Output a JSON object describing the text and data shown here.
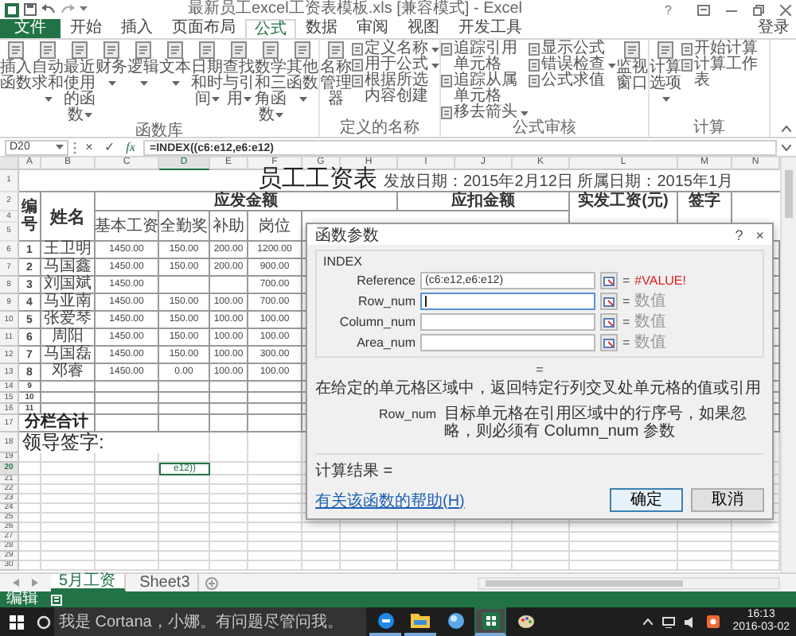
{
  "window": {
    "title": "最新员工excel工资表模板.xls [兼容模式] - Excel",
    "help": "?",
    "sign_in": "登录"
  },
  "ribbon_tabs": [
    {
      "label": "文件",
      "kind": "file",
      "selected": false
    },
    {
      "label": "开始",
      "kind": "tab",
      "selected": false
    },
    {
      "label": "插入",
      "kind": "tab",
      "selected": false
    },
    {
      "label": "页面布局",
      "kind": "tab",
      "selected": false
    },
    {
      "label": "公式",
      "kind": "tab",
      "selected": true
    },
    {
      "label": "数据",
      "kind": "tab",
      "selected": false
    },
    {
      "label": "审阅",
      "kind": "tab",
      "selected": false
    },
    {
      "label": "视图",
      "kind": "tab",
      "selected": false
    },
    {
      "label": "开发工具",
      "kind": "tab",
      "selected": false
    }
  ],
  "ribbon_groups": [
    {
      "label": "函数库",
      "items": [
        {
          "kind": "large",
          "label": "插入函数",
          "dropdown": false
        },
        {
          "kind": "large",
          "label": "自动求和",
          "dropdown": true
        },
        {
          "kind": "large",
          "label": "最近使用的函数",
          "dropdown": true
        },
        {
          "kind": "large",
          "label": "财务",
          "dropdown": true
        },
        {
          "kind": "large",
          "label": "逻辑",
          "dropdown": true
        },
        {
          "kind": "large",
          "label": "文本",
          "dropdown": true
        },
        {
          "kind": "large",
          "label": "日期和时间",
          "dropdown": true
        },
        {
          "kind": "large",
          "label": "查找与引用",
          "dropdown": true
        },
        {
          "kind": "large",
          "label": "数学和三角函数",
          "dropdown": true
        },
        {
          "kind": "large",
          "label": "其他函数",
          "dropdown": true
        }
      ]
    },
    {
      "label": "定义的名称",
      "items": [
        {
          "kind": "large",
          "label": "名称管理器",
          "dropdown": false
        },
        {
          "kind": "stack",
          "items": [
            {
              "label": "定义名称",
              "dropdown": true
            },
            {
              "label": "用于公式",
              "dropdown": true
            },
            {
              "label": "根据所选内容创建",
              "dropdown": false
            }
          ]
        }
      ]
    },
    {
      "label": "公式审核",
      "items": [
        {
          "kind": "stack",
          "items": [
            {
              "label": "追踪引用单元格",
              "dropdown": false
            },
            {
              "label": "追踪从属单元格",
              "dropdown": false
            },
            {
              "label": "移去箭头",
              "dropdown": true
            }
          ]
        },
        {
          "kind": "stack",
          "items": [
            {
              "label": "显示公式",
              "dropdown": false
            },
            {
              "label": "错误检查",
              "dropdown": true
            },
            {
              "label": "公式求值",
              "dropdown": false
            }
          ]
        },
        {
          "kind": "large",
          "label": "监视窗口",
          "dropdown": false
        }
      ]
    },
    {
      "label": "计算",
      "items": [
        {
          "kind": "large",
          "label": "计算选项",
          "dropdown": true
        },
        {
          "kind": "stack",
          "items": [
            {
              "label": "开始计算",
              "dropdown": false
            },
            {
              "label": "计算工作表",
              "dropdown": false
            }
          ]
        }
      ]
    }
  ],
  "formula_bar": {
    "name_box": "D20",
    "cancel": "×",
    "enter": "✓",
    "function": "fx",
    "formula": "=INDEX((c6:e12,e6:e12)"
  },
  "sheet": {
    "columns": [
      {
        "letter": "A",
        "selected": false
      },
      {
        "letter": "B",
        "selected": false
      },
      {
        "letter": "C",
        "selected": false
      },
      {
        "letter": "D",
        "selected": true
      },
      {
        "letter": "E",
        "selected": false
      },
      {
        "letter": "F",
        "selected": false
      },
      {
        "letter": "G",
        "selected": false
      },
      {
        "letter": "H",
        "selected": false
      },
      {
        "letter": "I",
        "selected": false
      },
      {
        "letter": "J",
        "selected": false
      },
      {
        "letter": "K",
        "selected": false
      },
      {
        "letter": "L",
        "selected": false
      },
      {
        "letter": "M",
        "selected": false
      },
      {
        "letter": "N",
        "selected": false
      }
    ],
    "header_row_numbers": [
      "1",
      "2",
      "4",
      "5"
    ],
    "title": "员工工资表",
    "dates": "发放日期：2015年2月12日 所属日期：2015年1月",
    "number_header": "编号",
    "name_header": "姓名",
    "pay_group": "应发金额",
    "deduct_group": "应扣金额",
    "net_header": "实发工资(元)",
    "sign_header": "签字",
    "pay_columns": [
      "基本工资",
      "全勤奖",
      "补助",
      "岗位"
    ],
    "rows": [
      {
        "kind": "person",
        "number": "6",
        "selected": false,
        "no": "1",
        "name": "王卫明",
        "base_pay": "1450.00",
        "attendance_bonus": "150.00",
        "allowance": "200.00",
        "post_pay": "1200.00"
      },
      {
        "kind": "person",
        "number": "7",
        "selected": false,
        "no": "2",
        "name": "马国鑫",
        "base_pay": "1450.00",
        "attendance_bonus": "150.00",
        "allowance": "200.00",
        "post_pay": "900.00"
      },
      {
        "kind": "person",
        "number": "8",
        "selected": false,
        "no": "3",
        "name": "刘国斌",
        "base_pay": "1450.00",
        "post_pay": "700.00"
      },
      {
        "kind": "person",
        "number": "9",
        "selected": false,
        "no": "4",
        "name": "马亚南",
        "base_pay": "1450.00",
        "attendance_bonus": "150.00",
        "allowance": "100.00",
        "post_pay": "700.00"
      },
      {
        "kind": "person",
        "number": "10",
        "selected": false,
        "no": "5",
        "name": "张爱琴",
        "base_pay": "1450.00",
        "attendance_bonus": "150.00",
        "allowance": "100.00",
        "post_pay": "100.00"
      },
      {
        "kind": "person",
        "number": "11",
        "selected": false,
        "no": "6",
        "name": "周阳",
        "base_pay": "1450.00",
        "attendance_bonus": "150.00",
        "allowance": "100.00",
        "post_pay": "100.00"
      },
      {
        "kind": "person",
        "number": "12",
        "selected": false,
        "no": "7",
        "name": "马国磊",
        "base_pay": "1450.00",
        "attendance_bonus": "150.00",
        "allowance": "100.00",
        "post_pay": "300.00"
      },
      {
        "kind": "person",
        "number": "13",
        "selected": false,
        "no": "8",
        "name": "邓睿",
        "base_pay": "1450.00",
        "attendance_bonus": "0.00",
        "allowance": "100.00",
        "post_pay": "100.00"
      },
      {
        "kind": "number",
        "number": "14",
        "selected": false,
        "no": "9"
      },
      {
        "kind": "number",
        "number": "15",
        "selected": false,
        "no": "10"
      },
      {
        "kind": "number",
        "number": "16",
        "selected": false,
        "no": "11"
      },
      {
        "kind": "total",
        "number": "17",
        "selected": false,
        "label": "分栏合计"
      },
      {
        "kind": "sign",
        "number": "18",
        "selected": false,
        "label": "领导签字:"
      },
      {
        "kind": "empty",
        "number": "19",
        "selected": false
      },
      {
        "kind": "edit",
        "number": "20",
        "selected": true,
        "text": "e12))"
      },
      {
        "kind": "empty",
        "number": "21",
        "selected": false
      },
      {
        "kind": "empty",
        "number": "22",
        "selected": false
      },
      {
        "kind": "empty",
        "number": "23",
        "selected": false
      },
      {
        "kind": "empty",
        "number": "24",
        "selected": false
      },
      {
        "kind": "empty",
        "number": "25",
        "selected": false
      },
      {
        "kind": "empty",
        "number": "26",
        "selected": false
      },
      {
        "kind": "empty",
        "number": "27",
        "selected": false
      },
      {
        "kind": "empty",
        "number": "28",
        "selected": false
      },
      {
        "kind": "empty",
        "number": "29",
        "selected": false
      },
      {
        "kind": "empty",
        "number": "30",
        "selected": false
      }
    ]
  },
  "dialog": {
    "title": "函数参数",
    "help": "?",
    "close": "×",
    "function": "INDEX",
    "args": [
      {
        "label": "Reference",
        "value": "(c6:e12,e6:e12)",
        "focused": false,
        "equals": "=",
        "result": "#VALUE!",
        "kind": "error"
      },
      {
        "label": "Row_num",
        "focused": true,
        "equals": "=",
        "result": "数值",
        "kind": "hint"
      },
      {
        "label": "Column_num",
        "focused": false,
        "equals": "=",
        "result": "数值",
        "kind": "hint"
      },
      {
        "label": "Area_num",
        "focused": false,
        "equals": "=",
        "result": "数值",
        "kind": "hint"
      }
    ],
    "pending_result": "=",
    "description": "在给定的单元格区域中，返回特定行列交叉处单元格的值或引用",
    "arg_help_name": "Row_num",
    "arg_help": "目标单元格在引用区域中的行序号，如果忽略，则必须有 Column_num 参数",
    "result_label": "计算结果 =",
    "help_link": "有关该函数的帮助(H)",
    "buttons": [
      {
        "label": "确定",
        "default": true
      },
      {
        "label": "取消",
        "default": false
      }
    ]
  },
  "sheet_tabs": [
    {
      "label": "5月工资",
      "selected": true
    },
    {
      "label": "Sheet3",
      "selected": false
    }
  ],
  "status_bar": {
    "mode": "编辑"
  },
  "taskbar": {
    "search": {
      "placeholder": "我是 Cortana，小娜。有问题尽管问我。"
    },
    "apps": [
      {
        "kind": "edge",
        "running": true,
        "active": false
      },
      {
        "kind": "folder",
        "running": true,
        "active": false
      },
      {
        "kind": "globe",
        "running": false,
        "active": false
      },
      {
        "kind": "excel",
        "running": true,
        "active": true
      },
      {
        "kind": "paint",
        "running": false,
        "active": false
      }
    ],
    "time": "16:13",
    "date": "2016-03-02"
  }
}
